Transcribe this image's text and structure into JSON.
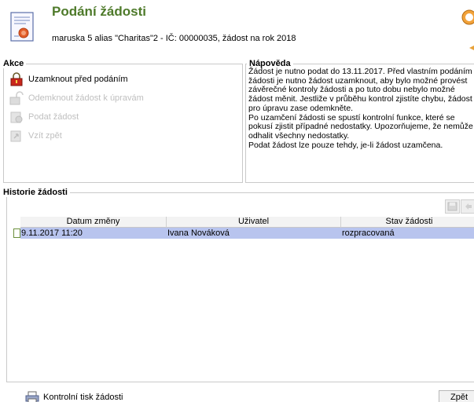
{
  "header": {
    "title": "Podání žádosti",
    "subtitle": "maruska 5 alias \"Charitas\"2 - IČ: 00000035, žádost na rok 2018"
  },
  "akce": {
    "legend": "Akce",
    "items": [
      {
        "label": "Uzamknout před podáním",
        "enabled": true,
        "icon": "lock-icon"
      },
      {
        "label": "Odemknout žádost k úpravám",
        "enabled": false,
        "icon": "unlock-icon"
      },
      {
        "label": "Podat žádost",
        "enabled": false,
        "icon": "submit-icon"
      },
      {
        "label": "Vzít zpět",
        "enabled": false,
        "icon": "withdraw-icon"
      }
    ]
  },
  "napoveda": {
    "legend": "Nápověda",
    "lines": [
      "Žádost je nutno podat do 13.11.2017. Před vlastním podáním",
      "žádosti je nutno žádost uzamknout, aby bylo možné provést",
      "závěrečné kontroly žádosti a po tuto dobu nebylo možné",
      "žádost měnit. Jestliže v průběhu kontrol zjistíte chybu, žádost",
      "pro úpravu zase odemkněte.",
      "Po uzamčení žádosti se spustí kontrolní funkce, které se",
      "pokusí zjistit případné nedostatky. Upozorňujeme, že nemůže",
      "odhalit všechny nedostatky.",
      "Podat žádost lze pouze tehdy, je-li žádost uzamčena."
    ]
  },
  "historie": {
    "legend": "Historie žádosti",
    "columns": [
      "Datum změny",
      "Uživatel",
      "Stav žádosti"
    ],
    "rows": [
      {
        "datum": "9.11.2017 11:20",
        "uzivatel": "Ivana Nováková",
        "stav": "rozpracovaná"
      }
    ]
  },
  "footer": {
    "print_label": "Kontrolní tisk žádosti",
    "back_label": "Zpět"
  },
  "colors": {
    "title": "#4e7a2a",
    "selected_row": "#b8c4ee",
    "disabled_text": "#bfbfbf"
  }
}
